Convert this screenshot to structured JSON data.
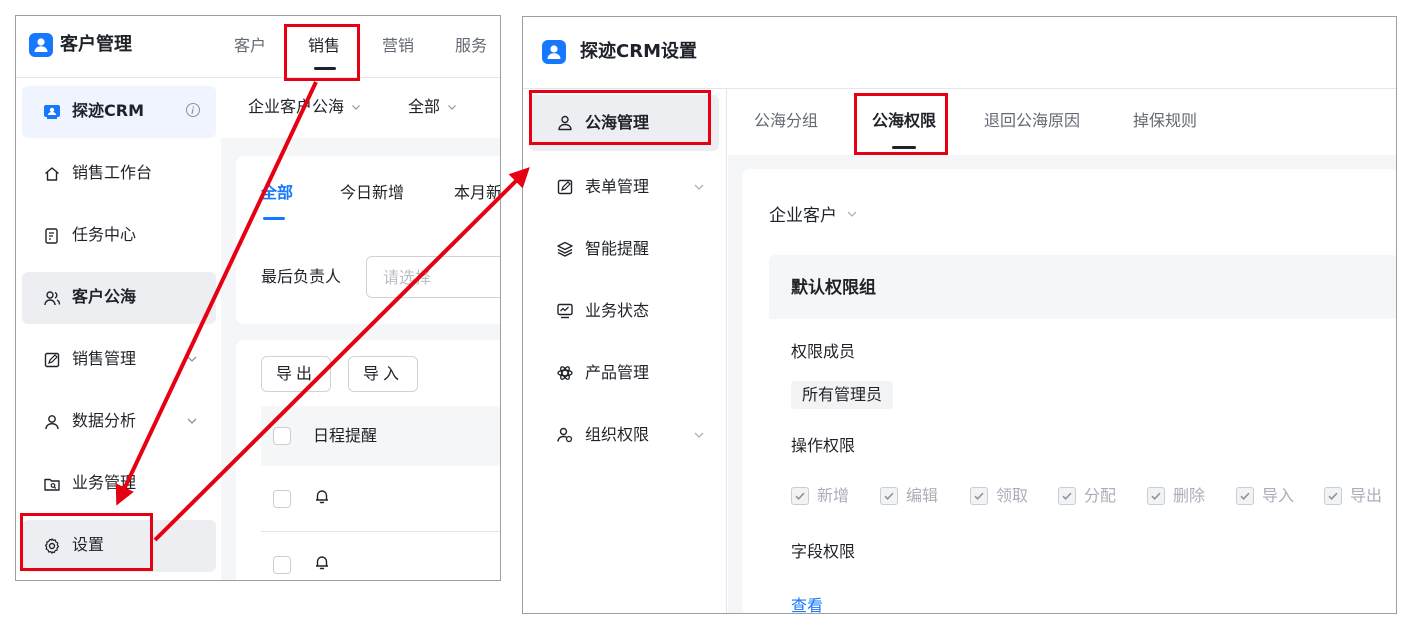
{
  "left": {
    "app_title": "客户管理",
    "top_tabs": [
      "客户",
      "销售",
      "营销",
      "服务"
    ],
    "sidebar": [
      {
        "label": "探迹CRM",
        "icon": "crm-logo-icon"
      },
      {
        "label": "销售工作台",
        "icon": "home-icon"
      },
      {
        "label": "任务中心",
        "icon": "task-icon"
      },
      {
        "label": "客户公海",
        "icon": "users-icon"
      },
      {
        "label": "销售管理",
        "icon": "edit-icon"
      },
      {
        "label": "数据分析",
        "icon": "people-icon"
      },
      {
        "label": "业务管理",
        "icon": "folder-search-icon"
      },
      {
        "label": "设置",
        "icon": "gear-icon"
      }
    ],
    "toolbar": {
      "filter1": "企业客户公海",
      "filter2": "全部"
    },
    "subtabs": [
      "全部",
      "今日新增",
      "本月新"
    ],
    "filter_label": "最后负责人",
    "filter_placeholder": "请选择",
    "buttons": {
      "export": "导出",
      "import": "导入"
    },
    "table_header": "日程提醒"
  },
  "right": {
    "app_title": "探迹CRM设置",
    "sidebar": [
      {
        "label": "公海管理",
        "icon": "user-group-icon"
      },
      {
        "label": "表单管理",
        "icon": "form-icon"
      },
      {
        "label": "智能提醒",
        "icon": "layers-icon"
      },
      {
        "label": "业务状态",
        "icon": "monitor-icon"
      },
      {
        "label": "产品管理",
        "icon": "atom-icon"
      },
      {
        "label": "组织权限",
        "icon": "org-icon"
      }
    ],
    "tabs": [
      "公海分组",
      "公海权限",
      "退回公海原因",
      "掉保规则"
    ],
    "customer_type": "企业客户",
    "group_title": "默认权限组",
    "members_label": "权限成员",
    "member_tag": "所有管理员",
    "operations_label": "操作权限",
    "permissions": [
      "新增",
      "编辑",
      "领取",
      "分配",
      "删除",
      "导入",
      "导出"
    ],
    "fields_label": "字段权限",
    "view_link": "查看"
  },
  "colors": {
    "accent": "#1677ff",
    "annotation": "#e60012",
    "selected_bg": "#eceef1"
  }
}
